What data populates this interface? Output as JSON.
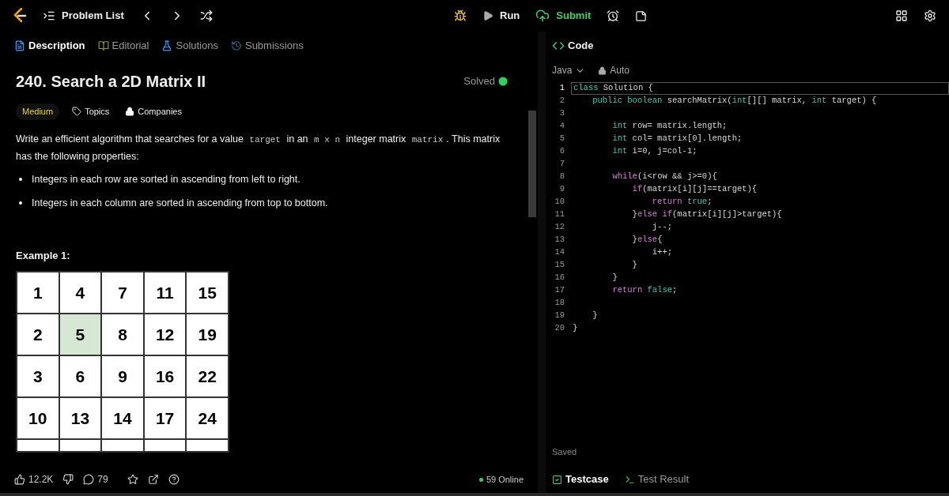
{
  "top_bar": {
    "problem_list": "Problem List",
    "run": "Run",
    "submit": "Submit"
  },
  "tabs": [
    {
      "label": "Description",
      "selected": true,
      "kind": "description"
    },
    {
      "label": "Editorial",
      "selected": false,
      "kind": "editorial"
    },
    {
      "label": "Solutions",
      "selected": false,
      "kind": "solutions"
    },
    {
      "label": "Submissions",
      "selected": false,
      "kind": "submissions"
    }
  ],
  "problem": {
    "title": "240. Search a 2D Matrix II",
    "status": "Solved",
    "solved": true,
    "difficulty": "Medium",
    "topics": "Topics",
    "companies": "Companies",
    "description_parts": [
      {
        "t": "Write an efficient algorithm that searches for a value ",
        "kind": "text"
      },
      {
        "t": "target",
        "kind": "code"
      },
      {
        "t": " in an ",
        "kind": "text"
      },
      {
        "t": "m x n",
        "kind": "code"
      },
      {
        "t": " integer matrix ",
        "kind": "text"
      },
      {
        "t": "matrix",
        "kind": "code"
      },
      {
        "t": ". This matrix has the following properties:",
        "kind": "text"
      }
    ],
    "bullets": [
      "Integers in each row are sorted in ascending from left to right.",
      "Integers in each column are sorted in ascending from top to bottom."
    ],
    "example_title": "Example 1:",
    "matrix": [
      [
        {
          "v": "1",
          "selected": false
        },
        {
          "v": "4",
          "selected": false
        },
        {
          "v": "7",
          "selected": false
        },
        {
          "v": "11",
          "selected": false
        },
        {
          "v": "15",
          "selected": false
        }
      ],
      [
        {
          "v": "2",
          "selected": false
        },
        {
          "v": "5",
          "selected": true
        },
        {
          "v": "8",
          "selected": false
        },
        {
          "v": "12",
          "selected": false
        },
        {
          "v": "19",
          "selected": false
        }
      ],
      [
        {
          "v": "3",
          "selected": false
        },
        {
          "v": "6",
          "selected": false
        },
        {
          "v": "9",
          "selected": false
        },
        {
          "v": "16",
          "selected": false
        },
        {
          "v": "22",
          "selected": false
        }
      ],
      [
        {
          "v": "10",
          "selected": false
        },
        {
          "v": "13",
          "selected": false
        },
        {
          "v": "14",
          "selected": false
        },
        {
          "v": "17",
          "selected": false
        },
        {
          "v": "24",
          "selected": false
        }
      ]
    ]
  },
  "footer": {
    "likes": "12.2K",
    "comments": "79",
    "online": "59 Online"
  },
  "code_panel": {
    "title": "Code",
    "language": "Java",
    "mode": "Auto",
    "saved": "Saved",
    "lines": [
      {
        "n": "1",
        "tokens": [
          {
            "t": "class",
            "kind": "kw"
          },
          {
            "t": " Solution {",
            "kind": "id"
          }
        ]
      },
      {
        "n": "2",
        "tokens": [
          {
            "t": "    public boolean",
            "kind": "kw"
          },
          {
            "t": " searchMatrix(",
            "kind": "id"
          },
          {
            "t": "int",
            "kind": "kw"
          },
          {
            "t": "[][] matrix, ",
            "kind": "id"
          },
          {
            "t": "int",
            "kind": "kw"
          },
          {
            "t": " target) {",
            "kind": "id"
          }
        ]
      },
      {
        "n": "3"
      },
      {
        "n": "4",
        "tokens": [
          {
            "t": "        int",
            "kind": "kw"
          },
          {
            "t": " row= matrix.length;",
            "kind": "id"
          }
        ]
      },
      {
        "n": "5",
        "tokens": [
          {
            "t": "        int",
            "kind": "kw"
          },
          {
            "t": " col= matrix[0].length;",
            "kind": "id"
          }
        ]
      },
      {
        "n": "6",
        "tokens": [
          {
            "t": "        int",
            "kind": "kw"
          },
          {
            "t": " i=0, j=col-1;",
            "kind": "id"
          }
        ]
      },
      {
        "n": "7"
      },
      {
        "n": "8",
        "tokens": [
          {
            "t": "        while",
            "kind": "ctrl"
          },
          {
            "t": "(i<row && j>=0){",
            "kind": "id"
          }
        ]
      },
      {
        "n": "9",
        "tokens": [
          {
            "t": "            if",
            "kind": "ctrl"
          },
          {
            "t": "(matrix[i][j]==target){",
            "kind": "id"
          }
        ]
      },
      {
        "n": "10",
        "tokens": [
          {
            "t": "                return",
            "kind": "ctrl"
          },
          {
            "t": " true",
            "kind": "kw"
          },
          {
            "t": ";",
            "kind": "id"
          }
        ]
      },
      {
        "n": "11",
        "tokens": [
          {
            "t": "            }",
            "kind": "id"
          },
          {
            "t": "else if",
            "kind": "ctrl"
          },
          {
            "t": "(matrix[i][j]>target){",
            "kind": "id"
          }
        ]
      },
      {
        "n": "12",
        "tokens": [
          {
            "t": "                j--;",
            "kind": "id"
          }
        ]
      },
      {
        "n": "13",
        "tokens": [
          {
            "t": "            }",
            "kind": "id"
          },
          {
            "t": "else",
            "kind": "ctrl"
          },
          {
            "t": "{",
            "kind": "id"
          }
        ]
      },
      {
        "n": "14",
        "tokens": [
          {
            "t": "                i++;",
            "kind": "id"
          }
        ]
      },
      {
        "n": "15",
        "tokens": [
          {
            "t": "            }",
            "kind": "id"
          }
        ]
      },
      {
        "n": "16",
        "tokens": [
          {
            "t": "        }",
            "kind": "id"
          }
        ]
      },
      {
        "n": "17",
        "tokens": [
          {
            "t": "        return",
            "kind": "ctrl"
          },
          {
            "t": " false",
            "kind": "kw"
          },
          {
            "t": ";",
            "kind": "id"
          }
        ]
      },
      {
        "n": "18"
      },
      {
        "n": "19",
        "tokens": [
          {
            "t": "    }",
            "kind": "id"
          }
        ]
      },
      {
        "n": "20",
        "tokens": [
          {
            "t": "}",
            "kind": "id"
          }
        ]
      }
    ]
  },
  "bottom_tabs": [
    {
      "label": "Testcase",
      "selected": true,
      "kind": "testcase"
    },
    {
      "label": "Test Result",
      "selected": false,
      "kind": "result"
    }
  ]
}
